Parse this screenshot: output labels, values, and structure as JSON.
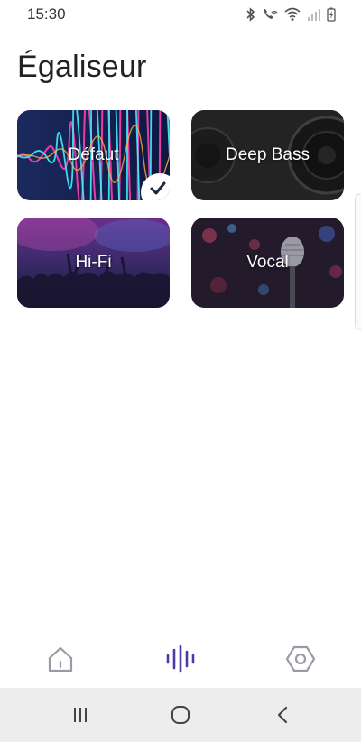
{
  "status_bar": {
    "time": "15:30",
    "icons": [
      "bluetooth-icon",
      "wifi-calling-icon",
      "wifi-icon",
      "signal-icon",
      "battery-charging-icon"
    ]
  },
  "page": {
    "title": "Égaliseur"
  },
  "presets": [
    {
      "label": "Défaut",
      "selected": true
    },
    {
      "label": "Deep Bass",
      "selected": false
    },
    {
      "label": "Hi-Fi",
      "selected": false
    },
    {
      "label": "Vocal",
      "selected": false
    }
  ],
  "bottom_nav": {
    "items": [
      {
        "icon": "home-icon",
        "active": false
      },
      {
        "icon": "equalizer-icon",
        "active": true
      },
      {
        "icon": "settings-hexagon-icon",
        "active": false
      }
    ],
    "active_color": "#4a3ba8",
    "inactive_color": "#9a9aa6"
  },
  "system_nav": {
    "icons": [
      "recent-apps-icon",
      "home-circle-icon",
      "back-icon"
    ]
  }
}
